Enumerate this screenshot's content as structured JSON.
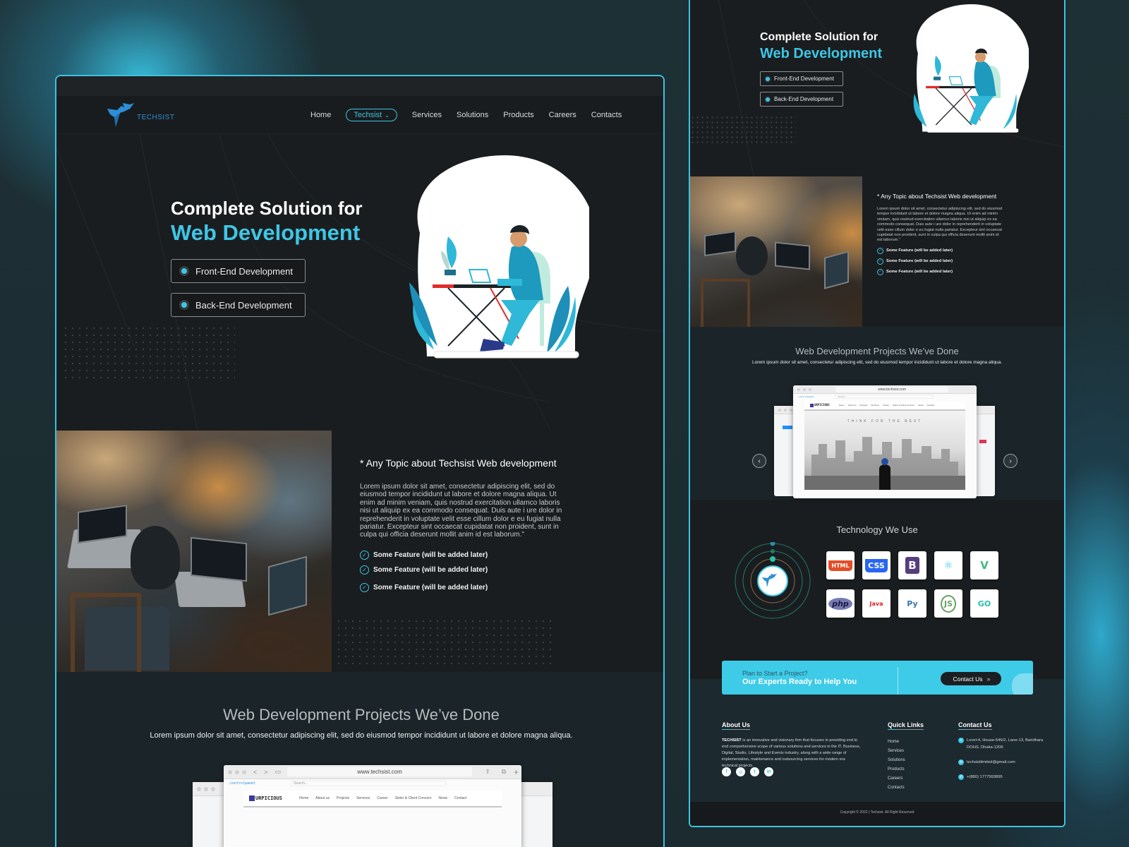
{
  "brand": {
    "name": "TECHSIST",
    "accent_color": "#3ec6e6",
    "frame_color": "#3ec2e0",
    "background_color": "#1a1d1f"
  },
  "nav": {
    "items": [
      {
        "label": "Home",
        "active": false
      },
      {
        "label": "Techsist",
        "active": true,
        "has_dropdown": true
      },
      {
        "label": "Services",
        "active": false
      },
      {
        "label": "Solutions",
        "active": false
      },
      {
        "label": "Products",
        "active": false
      },
      {
        "label": "Careers",
        "active": false
      },
      {
        "label": "Contacts",
        "active": false
      }
    ]
  },
  "hero": {
    "title_line1": "Complete Solution for",
    "title_line2": "Web Development",
    "pills": [
      "Front-End Development",
      "Back-End Development"
    ]
  },
  "topic": {
    "title": "* Any Topic about Techsist Web development",
    "body": "Lorem ipsum dolor sit amet, consectetur adipiscing elit, sed do eiusmod tempor incididunt ut labore et dolore magna aliqua. Ut enim ad minim veniam, quis nostrud exercitation ullamco laboris nisi ut aliquip ex ea commodo consequat. Duis aute i ure dolor in reprehenderit in voluptate velit esse cillum dolor e eu fugiat nulla pariatur. Excepteur sint occaecat cupidatat non proident, sunt in culpa qui officia deserunt mollit anim id est laborum.\"",
    "features": [
      "Some Feature (will be added later)",
      "Some Feature (will be added later)",
      "Some Feature (will be added later)"
    ]
  },
  "projects": {
    "title": "Web Development Projects We’ve Done",
    "subtitle": "Lorem ipsum dolor sit amet, consectetur adipiscing elit, sed do eiusmod tempor incididunt ut labore et dolore magna aliqua.",
    "browser": {
      "url": "www.techsist.com",
      "controlpanel_label": ".controlpanel",
      "search_placeholder": "Search...",
      "site_logo": "URPICIOUS",
      "site_nav": [
        "Home",
        "About us",
        "Projects",
        "Services",
        "Career",
        "Sister & Client Concern",
        "News",
        "Contact"
      ],
      "hero_text": "THINK FOR THE BEST"
    },
    "prev_label": "‹",
    "next_label": "›"
  },
  "technology": {
    "title": "Technology We Use",
    "items": [
      {
        "name": "HTML5",
        "label": "HTML",
        "color": "#e44d26"
      },
      {
        "name": "CSS3",
        "label": "CSS",
        "color": "#2965f1"
      },
      {
        "name": "Bootstrap",
        "label": "B",
        "color": "#563d7c"
      },
      {
        "name": "React",
        "label": "⚛",
        "color": "#3fc9f1"
      },
      {
        "name": "Vue",
        "label": "V",
        "color": "#41b883"
      },
      {
        "name": "PHP",
        "label": "php",
        "color": "#777bb3"
      },
      {
        "name": "Java",
        "label": "Java",
        "color": "#e11f21"
      },
      {
        "name": "Python",
        "label": "Py",
        "color": "#3776ab"
      },
      {
        "name": "Node.js",
        "label": "JS",
        "color": "#68a063"
      },
      {
        "name": "Go",
        "label": "GO",
        "color": "#29beb0"
      }
    ]
  },
  "cta": {
    "line1": "Plan to Start a Project?",
    "line2": "Our Experts Ready to Help You",
    "button_label": "Contact Us",
    "button_arrow": "»"
  },
  "footer": {
    "about_title": "About Us",
    "about_brand": "TECHSIST",
    "about_text": " is an innovative and visionary firm that focuses in providing end to end comprehensive scope of various solutions and services in the IT, Business, Digital, Studio, Lifestyle and Events industry, along with a wide range of implementation, maintenance and outsourcing services for modern era technical projects.",
    "social": [
      {
        "name": "facebook",
        "glyph": "f"
      },
      {
        "name": "instagram",
        "glyph": "◎"
      },
      {
        "name": "twitter",
        "glyph": "t"
      },
      {
        "name": "linkedin",
        "glyph": "in"
      }
    ],
    "quick_links_title": "Quick Links",
    "quick_links": [
      "Home",
      "Services",
      "Solutions",
      "Products",
      "Careers",
      "Contacts"
    ],
    "contact_title": "Contact Us",
    "address": "Level-4, House-546/2, Lane-13, Baridhara DOHS, Dhaka-1206",
    "email": "techsistlimited@gmail.com",
    "phone": "+(880) 1777993895",
    "copyright": "Copyright © 2022 | Techsist. All Right Reserved"
  }
}
